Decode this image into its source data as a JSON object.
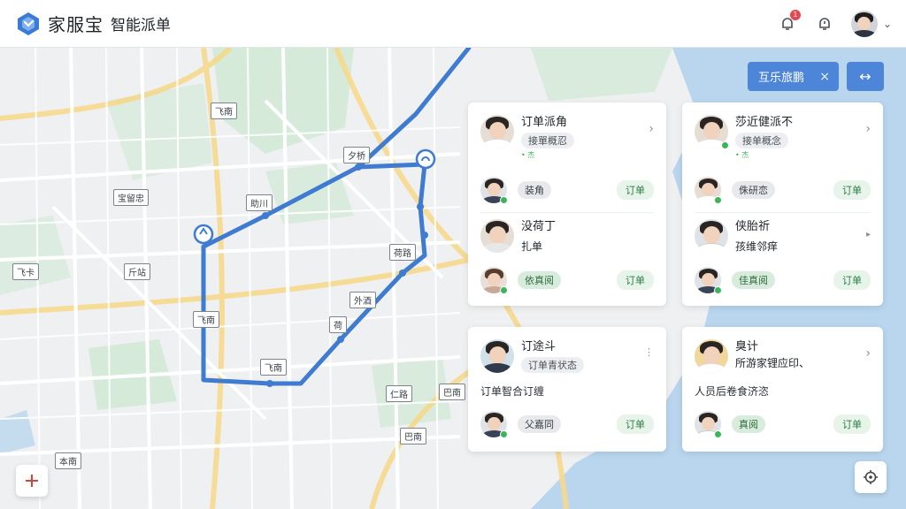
{
  "header": {
    "brand": "家服宝",
    "subtitle": "智能派单",
    "notification_badge": "1"
  },
  "map": {
    "labels": [
      "飞南",
      "夕桥",
      "宝留忠",
      "助川",
      "荷路",
      "飞卡",
      "斤站",
      "外酒",
      "飞南",
      "荷",
      "飞南",
      "仁路",
      "巴南",
      "本南"
    ],
    "route_color": "#3f7bd1"
  },
  "toolbar": {
    "filter_label": "互乐旅鹏",
    "filter_close": "×",
    "swap_icon": "↔"
  },
  "cards": [
    {
      "title": "订单派角",
      "tag": "接單概忍",
      "note": "• 杰",
      "rows": [
        {
          "chip": "装角",
          "chip_style": "gray",
          "action": "订单"
        }
      ],
      "section2_title": "没荷丁",
      "section2_sub": "扎单",
      "rows2": [
        {
          "chip": "依真阅",
          "chip_style": "green",
          "action": "订单"
        }
      ]
    },
    {
      "title": "莎近健派不",
      "tag": "接单概念",
      "note": "• 杰",
      "rows": [
        {
          "chip": "侏研恋",
          "chip_style": "gray",
          "action": "订单"
        }
      ],
      "section2_title": "侠胎祈",
      "section2_sub": "孩维邻痒",
      "rows2": [
        {
          "chip": "佳真阅",
          "chip_style": "green",
          "action": "订单"
        }
      ]
    },
    {
      "title": "订途斗",
      "tag": "订单青状态",
      "body": "订单智合订缠",
      "rows": [
        {
          "chip": "父嘉同",
          "chip_style": "gray",
          "action": "订单"
        }
      ]
    },
    {
      "title": "臭计",
      "subtitle": "所游家锂应印、",
      "body": "人员后卷食济恣",
      "rows": [
        {
          "chip": "真阅",
          "chip_style": "green",
          "action": "订单"
        }
      ]
    }
  ]
}
